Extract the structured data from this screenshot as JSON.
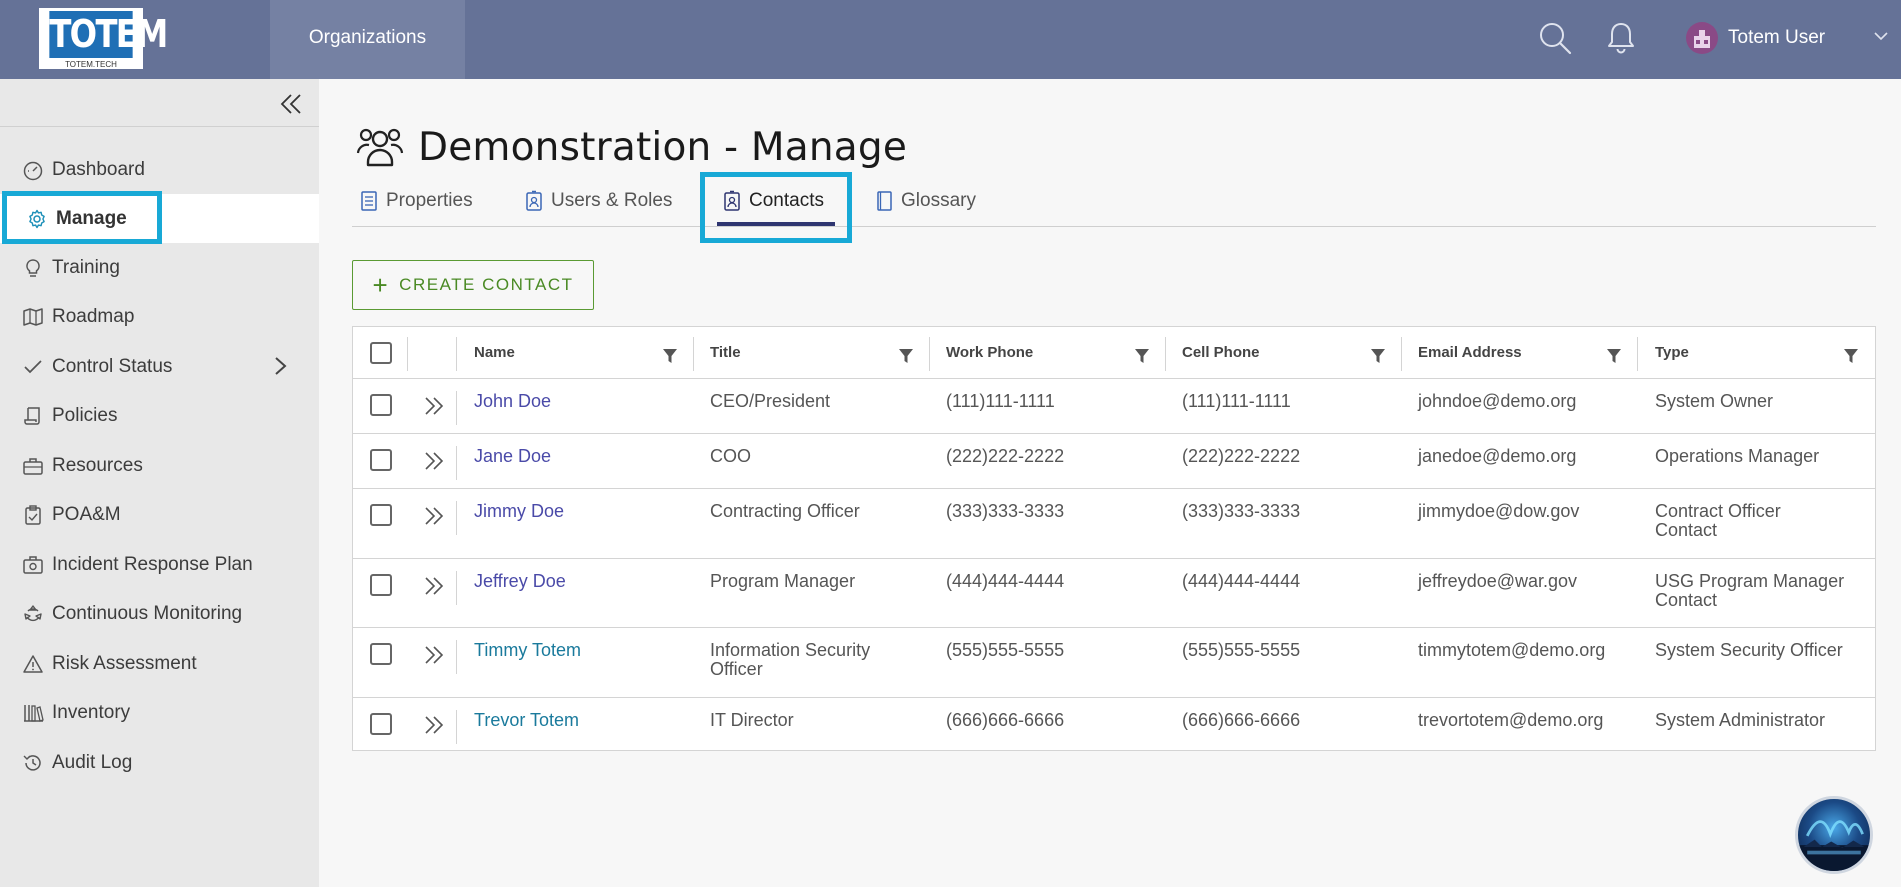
{
  "topbar": {
    "logo_text": "TOTEM",
    "logo_sub": "TOTEM.TECH",
    "nav_organizations": "Organizations",
    "user_name": "Totem User"
  },
  "sidebar": {
    "items": [
      {
        "label": "Dashboard",
        "icon": "dashboard-icon"
      },
      {
        "label": "Manage",
        "icon": "gear-icon"
      },
      {
        "label": "Training",
        "icon": "lightbulb-icon"
      },
      {
        "label": "Roadmap",
        "icon": "map-icon"
      },
      {
        "label": "Control Status",
        "icon": "check-icon"
      },
      {
        "label": "Policies",
        "icon": "scroll-icon"
      },
      {
        "label": "Resources",
        "icon": "toolbox-icon"
      },
      {
        "label": "POA&M",
        "icon": "clipboard-icon"
      },
      {
        "label": "Incident Response Plan",
        "icon": "first-aid-icon"
      },
      {
        "label": "Continuous Monitoring",
        "icon": "cycle-icon"
      },
      {
        "label": "Risk Assessment",
        "icon": "warning-icon"
      },
      {
        "label": "Inventory",
        "icon": "inventory-icon"
      },
      {
        "label": "Audit Log",
        "icon": "history-icon"
      }
    ]
  },
  "page": {
    "title": "Demonstration - Manage"
  },
  "tabs": [
    {
      "label": "Properties"
    },
    {
      "label": "Users & Roles"
    },
    {
      "label": "Contacts"
    },
    {
      "label": "Glossary"
    }
  ],
  "create_button": "CREATE CONTACT",
  "table": {
    "columns": [
      "Name",
      "Title",
      "Work Phone",
      "Cell Phone",
      "Email Address",
      "Type"
    ],
    "rows": [
      {
        "name": "John Doe",
        "title": "CEO/President",
        "work": "(111)111-1111",
        "cell": "(111)111-1111",
        "email": "johndoe@demo.org",
        "type": "System Owner"
      },
      {
        "name": "Jane Doe",
        "title": "COO",
        "work": "(222)222-2222",
        "cell": "(222)222-2222",
        "email": "janedoe@demo.org",
        "type": "Operations Manager"
      },
      {
        "name": "Jimmy Doe",
        "title": "Contracting Officer",
        "work": "(333)333-3333",
        "cell": "(333)333-3333",
        "email": "jimmydoe@dow.gov",
        "type_line1": "Contract Officer",
        "type_line2": "Contact"
      },
      {
        "name": "Jeffrey Doe",
        "title": "Program Manager",
        "work": "(444)444-4444",
        "cell": "(444)444-4444",
        "email": "jeffreydoe@war.gov",
        "type_line1": "USG Program Manager",
        "type_line2": "Contact"
      },
      {
        "name": "Timmy Totem",
        "title_line1": "Information Security",
        "title_line2": "Officer",
        "work": "(555)555-5555",
        "cell": "(555)555-5555",
        "email": "timmytotem@demo.org",
        "type": "System Security Officer"
      },
      {
        "name": "Trevor Totem",
        "title": "IT Director",
        "work": "(666)666-6666",
        "cell": "(666)666-6666",
        "email": "trevortotem@demo.org",
        "type": "System Administrator"
      }
    ]
  },
  "colors": {
    "topbar": "#657297",
    "highlight": "#18a9d6",
    "create_green": "#4a8a24",
    "link": "#4a4aa8"
  }
}
